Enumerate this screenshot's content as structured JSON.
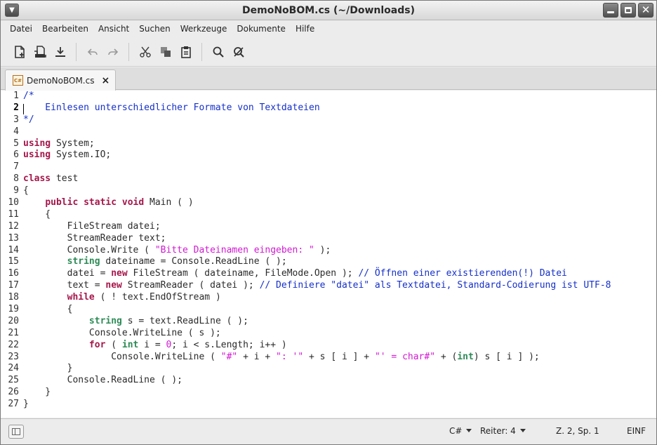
{
  "window": {
    "title": "DemoNoBOM.cs (~/Downloads)"
  },
  "menu": [
    "Datei",
    "Bearbeiten",
    "Ansicht",
    "Suchen",
    "Werkzeuge",
    "Dokumente",
    "Hilfe"
  ],
  "tab": {
    "icon_text": "C#",
    "label": "DemoNoBOM.cs",
    "close": "×"
  },
  "editor": {
    "current_line": 2,
    "lines": [
      [
        [
          "com",
          "/*"
        ]
      ],
      [
        [
          "com",
          "    Einlesen unterschiedlicher Formate von Textdateien"
        ]
      ],
      [
        [
          "com",
          "*/"
        ]
      ],
      [],
      [
        [
          "kw",
          "using"
        ],
        [
          "plain",
          " System;"
        ]
      ],
      [
        [
          "kw",
          "using"
        ],
        [
          "plain",
          " System.IO;"
        ]
      ],
      [],
      [
        [
          "kw",
          "class"
        ],
        [
          "plain",
          " test"
        ]
      ],
      [
        [
          "plain",
          "{"
        ]
      ],
      [
        [
          "plain",
          "    "
        ],
        [
          "kw",
          "public static void"
        ],
        [
          "plain",
          " Main ( )"
        ]
      ],
      [
        [
          "plain",
          "    {"
        ]
      ],
      [
        [
          "plain",
          "        FileStream datei;"
        ]
      ],
      [
        [
          "plain",
          "        StreamReader text;"
        ]
      ],
      [
        [
          "plain",
          "        Console.Write ( "
        ],
        [
          "str",
          "\"Bitte Dateinamen eingeben: \""
        ],
        [
          "plain",
          " );"
        ]
      ],
      [
        [
          "plain",
          "        "
        ],
        [
          "type",
          "string"
        ],
        [
          "plain",
          " dateiname = Console.ReadLine ( );"
        ]
      ],
      [
        [
          "plain",
          "        datei = "
        ],
        [
          "kw",
          "new"
        ],
        [
          "plain",
          " FileStream ( dateiname, FileMode.Open ); "
        ],
        [
          "com",
          "// Öffnen einer existierenden(!) Datei"
        ]
      ],
      [
        [
          "plain",
          "        text = "
        ],
        [
          "kw",
          "new"
        ],
        [
          "plain",
          " StreamReader ( datei ); "
        ],
        [
          "com",
          "// Definiere \"datei\" als Textdatei, Standard-Codierung ist UTF-8"
        ]
      ],
      [
        [
          "plain",
          "        "
        ],
        [
          "kw",
          "while"
        ],
        [
          "plain",
          " ( ! text.EndOfStream )"
        ]
      ],
      [
        [
          "plain",
          "        {"
        ]
      ],
      [
        [
          "plain",
          "            "
        ],
        [
          "type",
          "string"
        ],
        [
          "plain",
          " s = text.ReadLine ( );"
        ]
      ],
      [
        [
          "plain",
          "            Console.WriteLine ( s );"
        ]
      ],
      [
        [
          "plain",
          "            "
        ],
        [
          "kw",
          "for"
        ],
        [
          "plain",
          " ( "
        ],
        [
          "type",
          "int"
        ],
        [
          "plain",
          " i = "
        ],
        [
          "num",
          "0"
        ],
        [
          "plain",
          "; i < s.Length; i++ )"
        ]
      ],
      [
        [
          "plain",
          "                Console.WriteLine ( "
        ],
        [
          "str",
          "\"#\""
        ],
        [
          "plain",
          " + i + "
        ],
        [
          "str",
          "\": '\""
        ],
        [
          "plain",
          " + s [ i ] + "
        ],
        [
          "str",
          "\"' = char#\""
        ],
        [
          "plain",
          " + ("
        ],
        [
          "type",
          "int"
        ],
        [
          "plain",
          ") s [ i ] );"
        ]
      ],
      [
        [
          "plain",
          "        }"
        ]
      ],
      [
        [
          "plain",
          "        Console.ReadLine ( );"
        ]
      ],
      [
        [
          "plain",
          "    }"
        ]
      ],
      [
        [
          "plain",
          "}"
        ]
      ]
    ]
  },
  "status": {
    "language": "C#",
    "tabs": "Reiter: 4",
    "position": "Z. 2, Sp. 1",
    "mode": "EINF"
  },
  "colors": {
    "keyword": "#a5164a",
    "type": "#2e8b57",
    "string": "#d21ad2",
    "comment": "#1530c8"
  }
}
